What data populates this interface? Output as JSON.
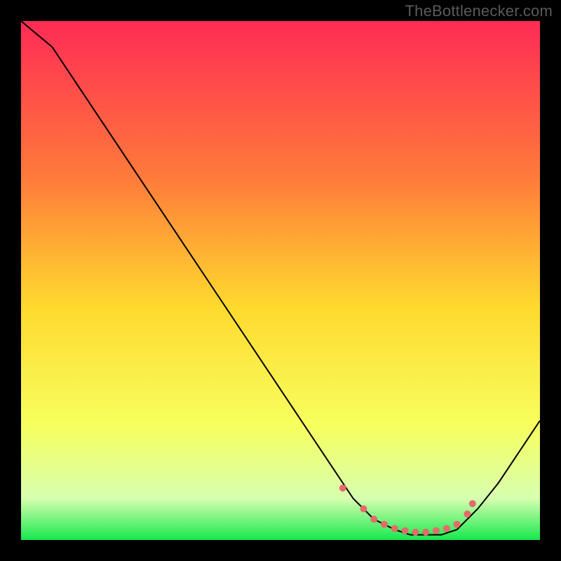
{
  "attribution": "TheBottlenecker.com",
  "colors": {
    "background": "#000000",
    "gradient_top": "#ff2b55",
    "gradient_mid_upper": "#ff7a3a",
    "gradient_mid": "#ffd92e",
    "gradient_mid_lower": "#f7ff5e",
    "gradient_low": "#d8ffb0",
    "gradient_bottom": "#17e84e",
    "curve": "#000000",
    "marker": "#e66a6a"
  },
  "chart_data": {
    "type": "line",
    "title": "",
    "xlabel": "",
    "ylabel": "",
    "xlim": [
      0,
      100
    ],
    "ylim": [
      0,
      100
    ],
    "series": [
      {
        "name": "bottleneck-curve",
        "x": [
          0,
          6,
          12,
          18,
          24,
          30,
          36,
          42,
          48,
          54,
          60,
          64,
          68,
          72,
          75,
          78,
          81,
          84,
          88,
          92,
          96,
          100
        ],
        "y": [
          100,
          95,
          86,
          77,
          68,
          59,
          50,
          41,
          32,
          23,
          14,
          8,
          4,
          2,
          1,
          1,
          1,
          2,
          6,
          11,
          17,
          23
        ]
      }
    ],
    "markers": {
      "name": "highlight-dots",
      "x": [
        62,
        66,
        68,
        70,
        72,
        74,
        76,
        78,
        80,
        82,
        84,
        86,
        87
      ],
      "y": [
        10,
        6,
        4,
        3,
        2.2,
        1.8,
        1.5,
        1.5,
        1.8,
        2.2,
        3,
        5,
        7
      ]
    }
  }
}
